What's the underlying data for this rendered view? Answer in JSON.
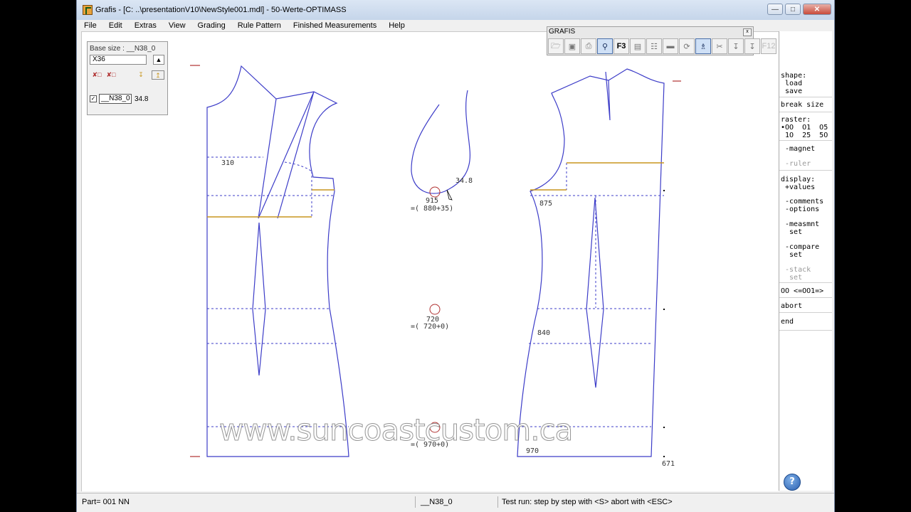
{
  "window": {
    "title": "Grafis - [C: ..\\presentationV10\\NewStyle001.mdl] - 50-Werte-OPTIMASS",
    "minimize": "—",
    "maximize": "□",
    "close": "✕"
  },
  "menu": [
    "File",
    "Edit",
    "Extras",
    "View",
    "Grading",
    "Rule Pattern",
    "Finished Measurements",
    "Help"
  ],
  "base_size_panel": {
    "label": "Base size : __N38_0",
    "selected": "X36",
    "size_name": "__N38_0",
    "size_value": "34.8",
    "checkbox": "✓"
  },
  "tool_palette": {
    "title": "GRAFIS",
    "close": "x",
    "f3_label": "F3",
    "f12_label": "F12"
  },
  "side_menu": {
    "shape": "shape:\n load\n save",
    "break_size": "break size",
    "raster": "raster:\n•OO  O1  O5\n 1O  25  5O",
    "magnet": " -magnet",
    "ruler": " -ruler",
    "display": "display:\n +values",
    "comments": " -comments\n -options",
    "measmnt": " -measmnt\n  set",
    "compare": " -compare\n  set",
    "stack": " -stack\n  set",
    "counter": "OO <=OO1=>",
    "abort": "abort",
    "end": "end",
    "help": "?"
  },
  "canvas_labels": {
    "l310": "310",
    "l34_8": "34.8",
    "l915": "915",
    "l915_eq": "=( 880+35)",
    "l875": "875",
    "l720": "720",
    "l720_eq": "=( 720+0)",
    "l840": "840",
    "l970_eq": "=( 970+0)",
    "l970": "970",
    "l671": "671"
  },
  "watermark": "www.suncoastcustom.ca",
  "status": {
    "part": "Part= 001  NN",
    "size": "__N38_0",
    "message": "Test run: step by step with <S> abort with <ESC>"
  },
  "colors": {
    "pattern_line": "#3c3cc8",
    "measure_line": "#c8961e",
    "marker": "#b03030"
  }
}
